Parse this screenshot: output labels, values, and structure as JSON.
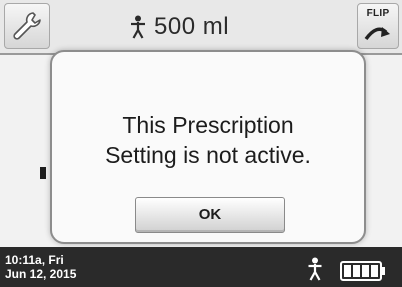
{
  "header": {
    "volume": "500 ml",
    "flip_label": "FLIP",
    "icons": {
      "settings": "wrench-icon",
      "person": "person-icon",
      "flip": "flip-arrow-icon"
    }
  },
  "dialog": {
    "line1": "This Prescription",
    "line2": "Setting is not active.",
    "ok_label": "OK"
  },
  "footer": {
    "time": "10:11a, Fri",
    "date": "Jun 12, 2015",
    "battery_level_bars": 4,
    "battery_max_bars": 4
  },
  "colors": {
    "footer_bg": "#2a2a2a",
    "screen_bg": "#efefef",
    "dialog_border": "#8d8d8d"
  }
}
